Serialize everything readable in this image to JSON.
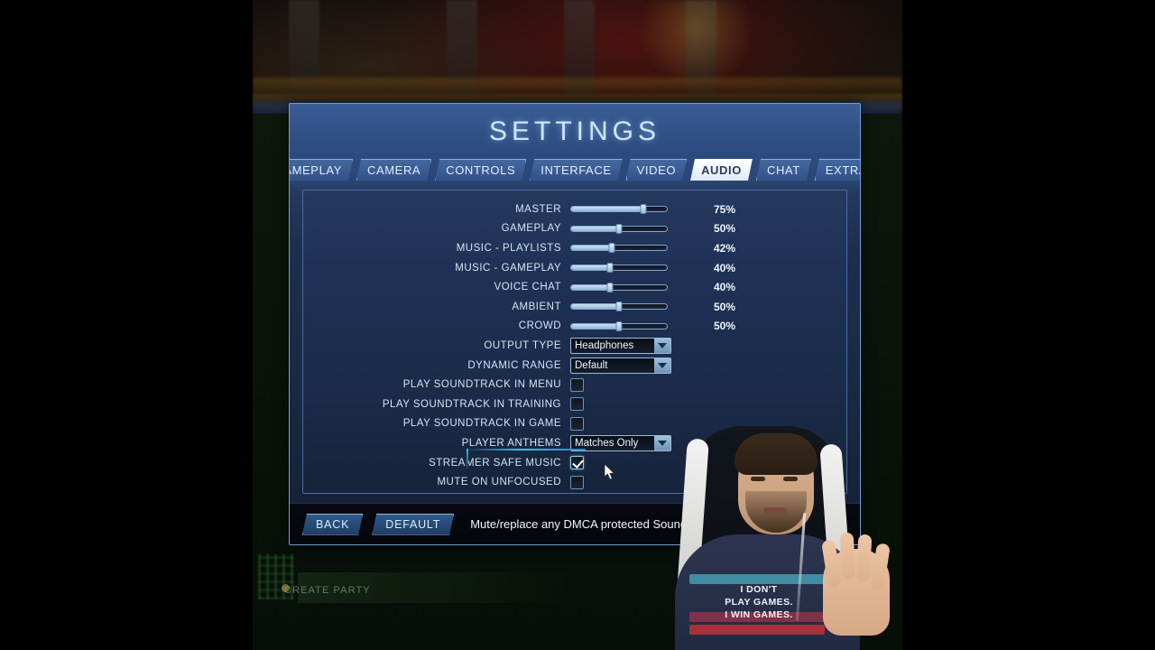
{
  "window": {
    "title": "SETTINGS",
    "tabs": [
      {
        "label": "GAMEPLAY",
        "active": false
      },
      {
        "label": "CAMERA",
        "active": false
      },
      {
        "label": "CONTROLS",
        "active": false
      },
      {
        "label": "INTERFACE",
        "active": false
      },
      {
        "label": "VIDEO",
        "active": false
      },
      {
        "label": "AUDIO",
        "active": true
      },
      {
        "label": "CHAT",
        "active": false
      },
      {
        "label": "EXTRAS",
        "active": false
      }
    ]
  },
  "audio": {
    "sliders": [
      {
        "label": "MASTER",
        "value": "75%",
        "percent": 75
      },
      {
        "label": "GAMEPLAY",
        "value": "50%",
        "percent": 50
      },
      {
        "label": "MUSIC - PLAYLISTS",
        "value": "42%",
        "percent": 42
      },
      {
        "label": "MUSIC - GAMEPLAY",
        "value": "40%",
        "percent": 40
      },
      {
        "label": "VOICE CHAT",
        "value": "40%",
        "percent": 40
      },
      {
        "label": "AMBIENT",
        "value": "50%",
        "percent": 50
      },
      {
        "label": "CROWD",
        "value": "50%",
        "percent": 50
      }
    ],
    "dropdowns": [
      {
        "label": "OUTPUT TYPE",
        "value": "Headphones"
      },
      {
        "label": "DYNAMIC RANGE",
        "value": "Default"
      }
    ],
    "checkboxes_upper": [
      {
        "label": "PLAY SOUNDTRACK IN MENU",
        "checked": false
      },
      {
        "label": "PLAY SOUNDTRACK IN TRAINING",
        "checked": false
      },
      {
        "label": "PLAY SOUNDTRACK IN GAME",
        "checked": false
      }
    ],
    "player_anthems": {
      "label": "PLAYER ANTHEMS",
      "value": "Matches Only"
    },
    "streamer_safe_music": {
      "label": "STREAMER SAFE MUSIC",
      "checked": true,
      "highlighted": true
    },
    "mute_on_unfocused": {
      "label": "MUTE ON UNFOCUSED",
      "checked": false
    }
  },
  "footer": {
    "back_label": "BACK",
    "default_label": "DEFAULT",
    "hint": "Mute/replace any DMCA protected Soundtracks"
  },
  "background": {
    "create_party": "CREATE PARTY"
  },
  "overlay": {
    "shirt_line1": "I DON'T",
    "shirt_line2": "PLAY GAMES.",
    "shirt_line3": "I WIN GAMES."
  },
  "colors": {
    "accent_cyan": "#2ec8e8",
    "panel_border": "#6f9ed0",
    "header_blue": "#2e4c80",
    "text_light": "#d6e4f4"
  }
}
